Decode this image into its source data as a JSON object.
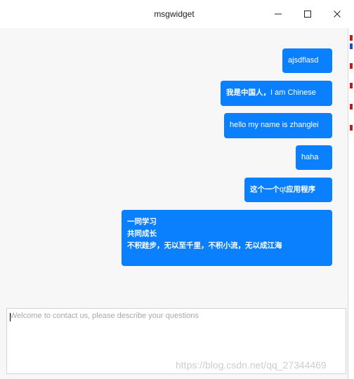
{
  "window": {
    "title": "msgwidget"
  },
  "messages": [
    {
      "text": "ajsdflasd"
    },
    {
      "text_cn": "我是中国人，",
      "text_en": "I am Chinese"
    },
    {
      "text": "hello my name is zhanglei"
    },
    {
      "text": "haha"
    },
    {
      "text_cn": "这个一个",
      "text_en": "qt",
      "text_cn2": "应用程序"
    },
    {
      "lines": [
        "一同学习",
        "共同成长",
        "不积跬步，无以至千里，不积小流，无以成江海"
      ]
    }
  ],
  "input": {
    "placeholder": "Welcome to contact us, please describe your questions",
    "value": ""
  },
  "watermark": "https://blog.csdn.net/qq_27344469",
  "colors": {
    "bubble": "#0a80ff",
    "background": "#f7f7f7"
  }
}
